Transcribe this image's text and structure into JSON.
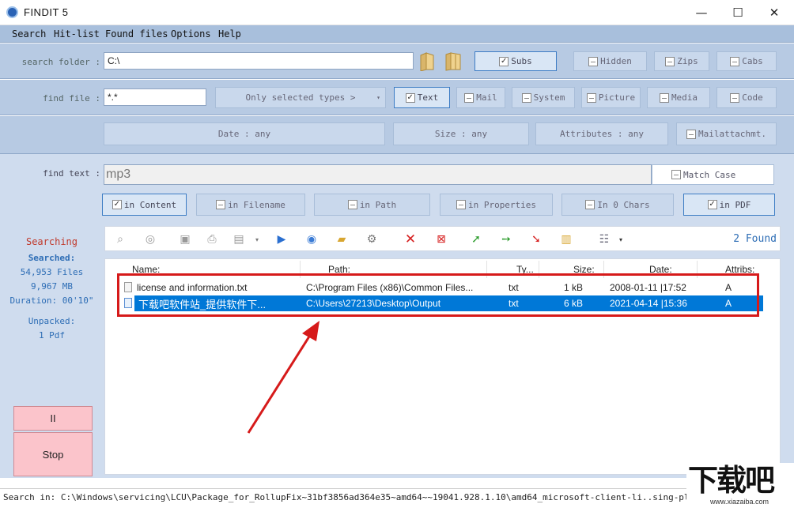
{
  "window": {
    "title": "FINDIT  5",
    "minimize": "—",
    "maximize": "☐",
    "close": "✕"
  },
  "menu": [
    "Search",
    "Hit-list",
    "Found files",
    "Options",
    "Help"
  ],
  "search_folder": {
    "label": "search folder :",
    "value": "C:\\"
  },
  "folder_options": {
    "subs": "Subs",
    "hidden": "Hidden",
    "zips": "Zips",
    "cabs": "Cabs"
  },
  "find_file": {
    "label": "find file :",
    "value": "*.*",
    "types_dropdown": "Only selected types >"
  },
  "file_types": {
    "text": "Text",
    "mail": "Mail",
    "system": "System",
    "picture": "Picture",
    "media": "Media",
    "code": "Code"
  },
  "filters": {
    "date": "Date : any",
    "size": "Size : any",
    "attributes": "Attributes : any",
    "mailattach": "Mailattachmt."
  },
  "find_text": {
    "label": "find text :",
    "value": "mp3",
    "match_case": "Match Case"
  },
  "search_scope": {
    "in_content": "in Content",
    "in_filename": "in Filename",
    "in_path": "in Path",
    "in_properties": "in Properties",
    "in_0_chars": "In 0 Chars",
    "in_pdf": "in PDF"
  },
  "sidebar": {
    "status": "Searching",
    "searched_label": "Searched:",
    "files": "54,953 Files",
    "size": "9,967 MB",
    "duration": "Duration: 00'10\"",
    "unpacked_label": "Unpacked:",
    "unpacked_value": "1 Pdf",
    "pause_label": "II",
    "stop_label": "Stop"
  },
  "found": {
    "text": "2 Found"
  },
  "results": {
    "columns": [
      "Name:",
      "Path:",
      "Ty...",
      "Size:",
      "Date:",
      "Attribs:"
    ],
    "rows": [
      {
        "name": "license and information.txt",
        "path": "C:\\Program Files (x86)\\Common Files...",
        "type": "txt",
        "size": "1 kB",
        "date": "2008-01-11 |17:52",
        "attribs": "A"
      },
      {
        "name": "下载吧软件站_提供软件下...",
        "path": "C:\\Users\\27213\\Desktop\\Output",
        "type": "txt",
        "size": "6 kB",
        "date": "2021-04-14 |15:36",
        "attribs": "A"
      }
    ]
  },
  "statusbar": {
    "text": "Search in: C:\\Windows\\servicing\\LCU\\Package_for_RollupFix~31bf3856ad364e35~amd64~~19041.928.1.10\\amd64_microsoft-client-li..sing-platform-winrt_"
  },
  "watermark": {
    "brand": "下载吧",
    "url": "www.xiazaiba.com"
  },
  "colors": {
    "band": "#b7cae3",
    "selection": "#0078d7",
    "highlight_box": "#d61a1a",
    "arrow": "#d61a1a",
    "searching": "#c0392b",
    "accent": "#2d6db5"
  }
}
